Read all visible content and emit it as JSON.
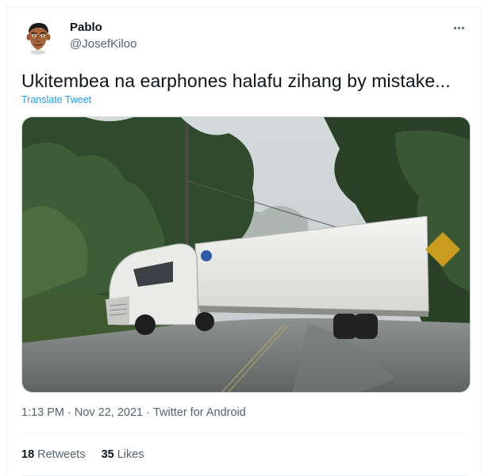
{
  "author": {
    "name": "Pablo",
    "handle": "@JosefKiloo",
    "avatar_icon": "cartoon-face-avatar"
  },
  "more_icon": "more-horizontal-icon",
  "tweet": {
    "text": "Ukitembea na earphones halafu zihang by mistake...",
    "translate_label": "Translate Tweet"
  },
  "media": {
    "description_icon": "photo-truck-jackknifed"
  },
  "meta": {
    "time": "1:13 PM",
    "separator1": "·",
    "date": "Nov 22, 2021",
    "separator2": "·",
    "client": "Twitter for Android"
  },
  "stats": {
    "retweets_count": "18",
    "retweets_label": "Retweets",
    "likes_count": "35",
    "likes_label": "Likes"
  },
  "colors": {
    "link": "#1d9bf0",
    "secondary_text": "#536471",
    "primary_text": "#0f1419",
    "border": "#eff3f4"
  }
}
